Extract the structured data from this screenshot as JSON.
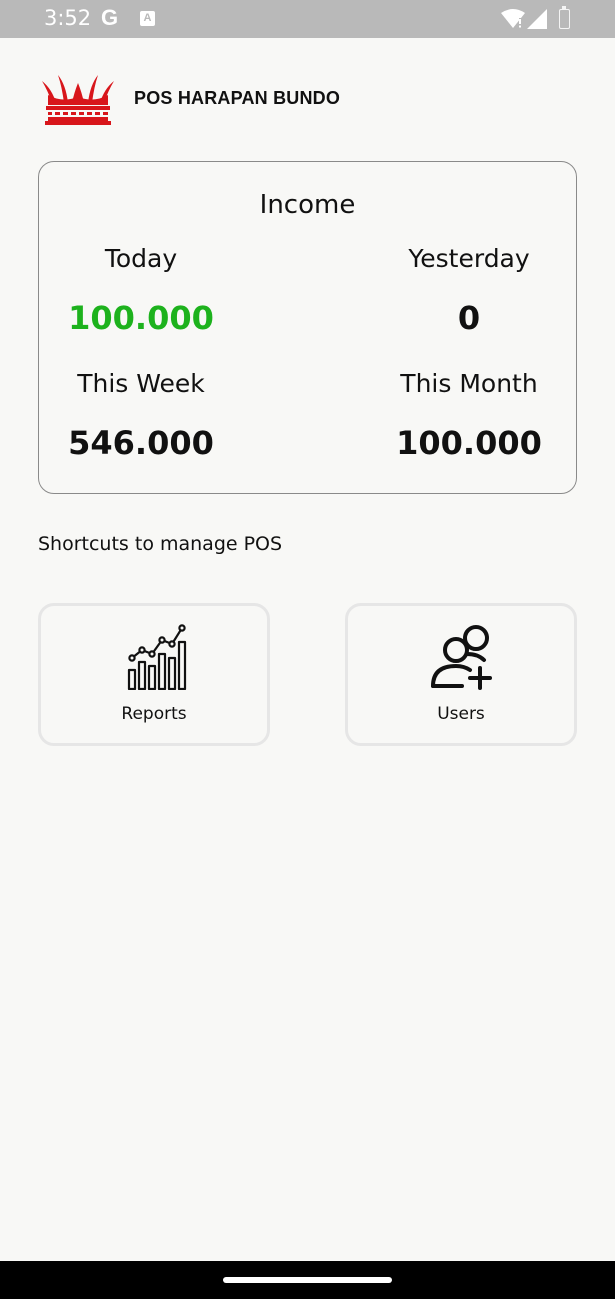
{
  "status_bar": {
    "time": "3:52",
    "icons": [
      "google-icon",
      "a-notification-icon",
      "wifi-icon",
      "signal-icon",
      "battery-icon"
    ]
  },
  "header": {
    "title": "POS HARAPAN BUNDO",
    "logo": "rumah-gadang-logo",
    "logo_color": "#d8161b"
  },
  "income": {
    "title": "Income",
    "today": {
      "label": "Today",
      "value": "100.000"
    },
    "yesterday": {
      "label": "Yesterday",
      "value": "0"
    },
    "this_week": {
      "label": "This Week",
      "value": "546.000"
    },
    "this_month": {
      "label": "This Month",
      "value": "100.000"
    },
    "positive_color": "#1db21d"
  },
  "shortcuts": {
    "title": "Shortcuts to manage POS",
    "items": [
      {
        "label": "Reports",
        "icon": "bar-chart-icon"
      },
      {
        "label": "Users",
        "icon": "add-user-icon"
      }
    ]
  },
  "colors": {
    "background": "#f8f8f6",
    "status_bar": "#b9b9b9",
    "card_border": "#8a8a8a",
    "shortcut_border": "#e6e6e6"
  }
}
